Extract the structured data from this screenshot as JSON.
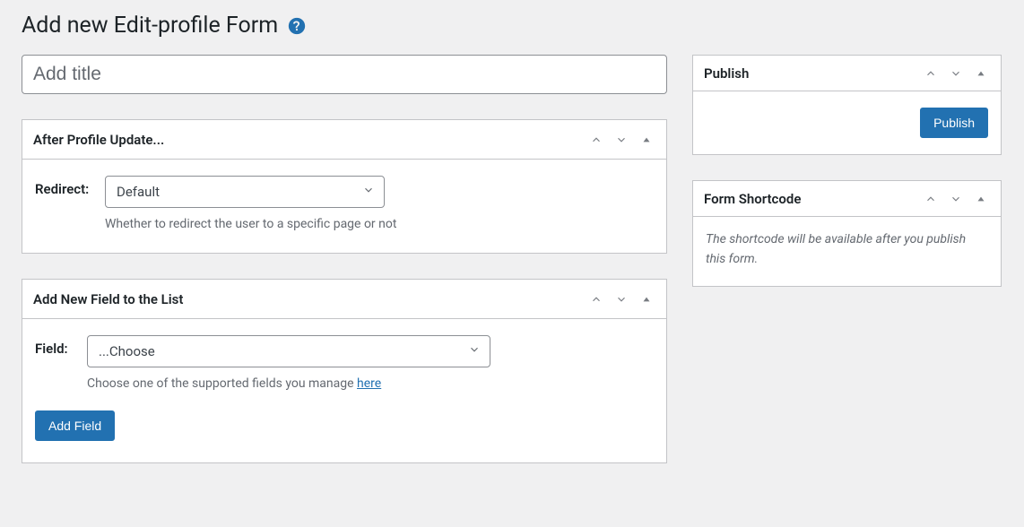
{
  "page": {
    "title": "Add new Edit-profile Form"
  },
  "main": {
    "title_placeholder": "Add title",
    "boxes": {
      "after_update": {
        "heading": "After Profile Update...",
        "redirect_label": "Redirect:",
        "redirect_value": "Default",
        "hint": "Whether to redirect the user to a specific page or not"
      },
      "add_field": {
        "heading": "Add New Field to the List",
        "field_label": "Field:",
        "field_value": "...Choose",
        "hint_prefix": "Choose one of the supported fields you manage ",
        "hint_link": "here",
        "button": "Add Field"
      }
    }
  },
  "sidebar": {
    "publish": {
      "heading": "Publish",
      "button": "Publish"
    },
    "shortcode": {
      "heading": "Form Shortcode",
      "note": "The shortcode will be available after you publish this form."
    }
  }
}
